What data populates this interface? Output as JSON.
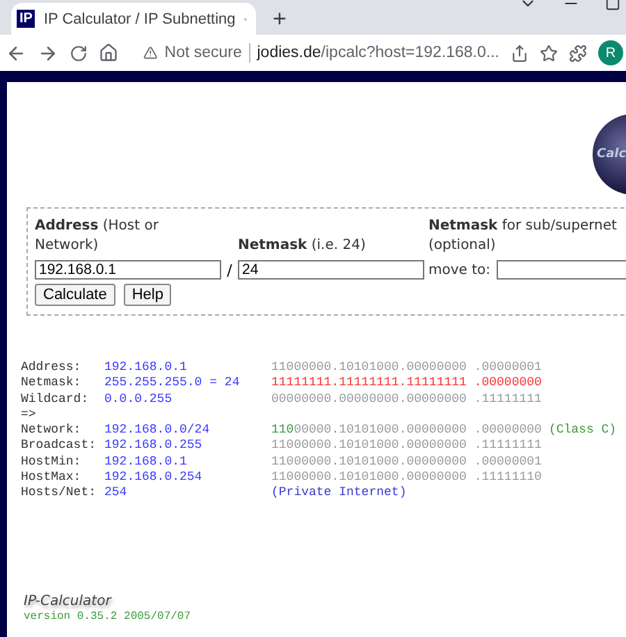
{
  "browser": {
    "tab": {
      "favicon": "IP",
      "title": "IP Calculator / IP Subnetting"
    },
    "new_tab": "+",
    "security": "Not secure",
    "url_host": "jodies.de",
    "url_path": "/ipcalc?host=192.168.0...",
    "profile": "R"
  },
  "logo_text": "Calc",
  "form": {
    "fields": [
      {
        "label": "**Address** (Host or Network)",
        "value": "192.168.0.1"
      },
      {
        "label": "**Netmask** (i.e. 24)",
        "value": "24"
      },
      {
        "label": "**Netmask** for sub/supernet (optional)"
      }
    ],
    "separator": "/",
    "move_to_label": "move to:",
    "buttons": [
      "Calculate",
      "Help"
    ]
  },
  "results": [
    {
      "label": "Address:",
      "value": "192.168.0.1",
      "binary": [
        {
          "text": "11000000.10101000.00000000 .00000001",
          "kind": "plain"
        }
      ]
    },
    {
      "label": "Netmask:",
      "value": "255.255.255.0 = 24",
      "binary": [
        {
          "text": "11111111.11111111.11111111 .00000000",
          "kind": "mask"
        }
      ]
    },
    {
      "label": "Wildcard:",
      "value": "0.0.0.255",
      "binary": [
        {
          "text": "00000000.00000000.00000000 .11111111",
          "kind": "plain"
        }
      ]
    },
    {
      "label": "=>"
    },
    {
      "label": "Network:",
      "value": "192.168.0.0/24",
      "binary": [
        {
          "text": "110",
          "kind": "class"
        },
        {
          "text": "00000.10101000.00000000 .00000000",
          "kind": "plain"
        }
      ],
      "note": {
        "text": "(Class C)",
        "kind": "class"
      }
    },
    {
      "label": "Broadcast:",
      "value": "192.168.0.255",
      "binary": [
        {
          "text": "11000000.10101000.00000000 .11111111",
          "kind": "plain"
        }
      ]
    },
    {
      "label": "HostMin:",
      "value": "192.168.0.1",
      "binary": [
        {
          "text": "11000000.10101000.00000000 .00000001",
          "kind": "plain"
        }
      ]
    },
    {
      "label": "HostMax:",
      "value": "192.168.0.254",
      "binary": [
        {
          "text": "11000000.10101000.00000000 .11111110",
          "kind": "plain"
        }
      ]
    },
    {
      "label": "Hosts/Net:",
      "value": "254",
      "note": {
        "text": "(Private Internet)",
        "kind": "info"
      }
    }
  ],
  "footer": {
    "title": "IP-Calculator",
    "version": "version 0.35.2 2005/07/07"
  }
}
